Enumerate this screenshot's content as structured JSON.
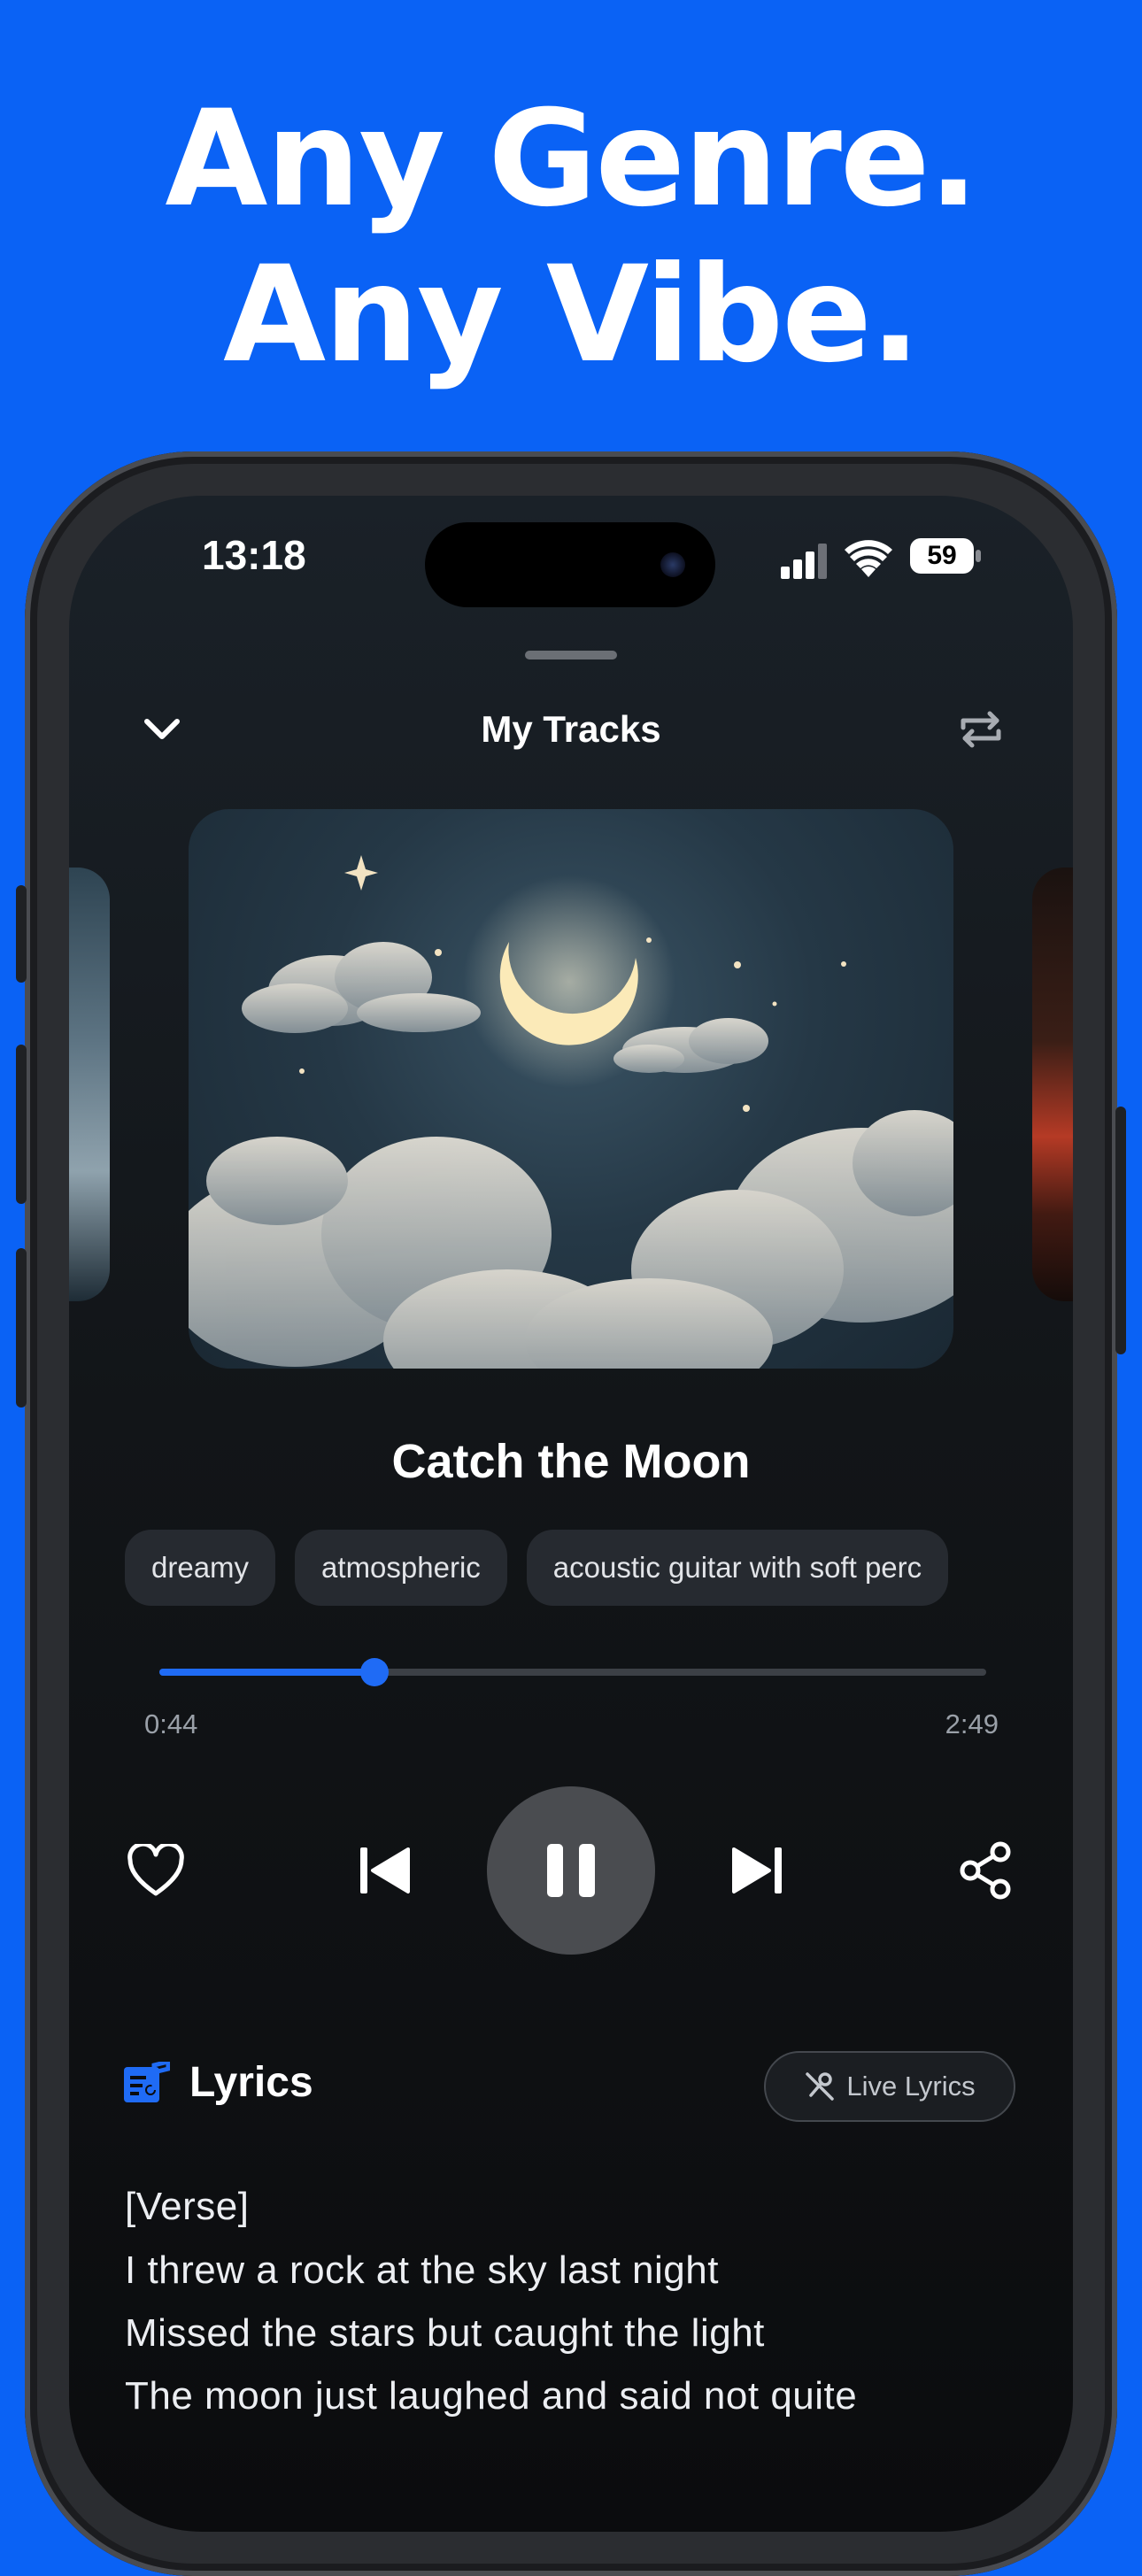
{
  "headline": {
    "line1": "Any Genre.",
    "line2": "Any Vibe."
  },
  "status_bar": {
    "time": "13:18",
    "battery": "59"
  },
  "player": {
    "title": "My Tracks",
    "song_title": "Catch the Moon",
    "tags": [
      "dreamy",
      "atmospheric",
      "acoustic guitar with soft perc"
    ],
    "progress": {
      "elapsed": "0:44",
      "duration": "2:49",
      "fraction": 0.26
    }
  },
  "lyrics": {
    "heading": "Lyrics",
    "live_button": "Live Lyrics",
    "lines": [
      "[Verse]",
      "I threw a rock at the sky last night",
      "Missed the stars but caught the light",
      "The moon just laughed and said not quite"
    ]
  },
  "colors": {
    "background": "#0a62f5",
    "accent": "#1f6bf5",
    "screen": "#121518"
  },
  "icons": [
    "chevron-down-icon",
    "repeat-icon",
    "heart-icon",
    "skip-previous-icon",
    "pause-icon",
    "skip-next-icon",
    "share-icon",
    "lyrics-icon",
    "live-lyrics-icon"
  ]
}
